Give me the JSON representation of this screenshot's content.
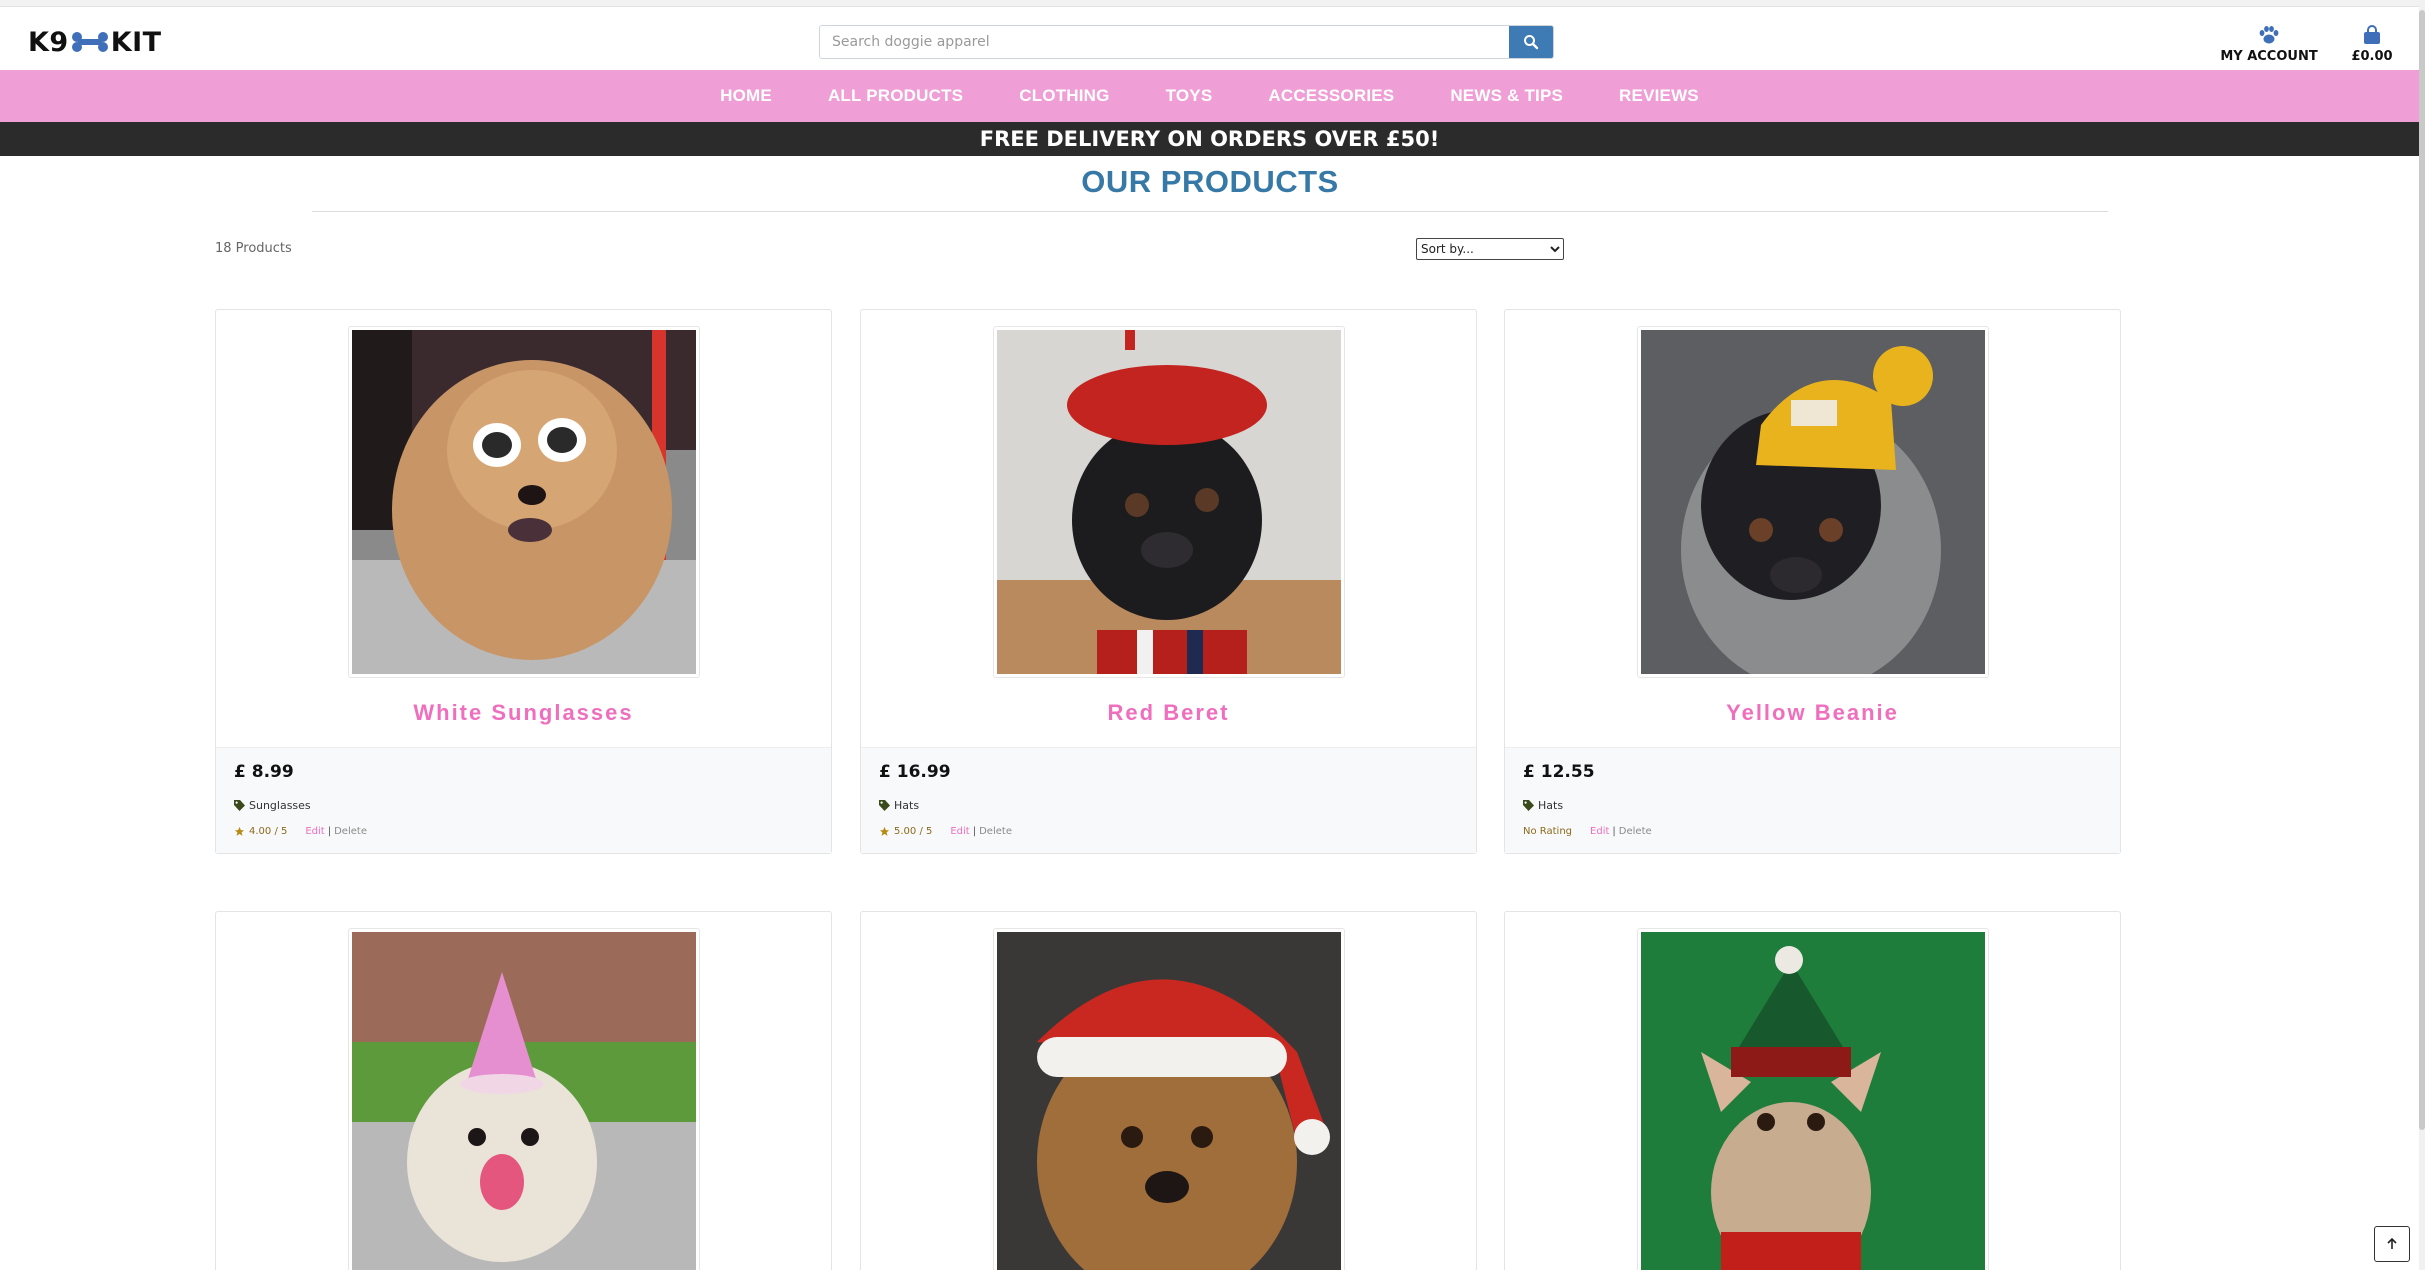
{
  "header": {
    "logo_left": "K9",
    "logo_right": "KIT",
    "search_placeholder": "Search doggie apparel",
    "account_label": "MY ACCOUNT",
    "cart_total": "£0.00"
  },
  "nav": {
    "items": [
      "HOME",
      "ALL PRODUCTS",
      "CLOTHING",
      "TOYS",
      "ACCESSORIES",
      "NEWS & TIPS",
      "REVIEWS"
    ]
  },
  "banner": {
    "text": "FREE DELIVERY ON ORDERS OVER £50!"
  },
  "main": {
    "title": "OUR PRODUCTS",
    "product_count": "18 Products",
    "sort_selected": "Sort by...",
    "products": [
      {
        "name": "White Sunglasses",
        "price": "£ 8.99",
        "category": "Sunglasses",
        "rating": "4.00 / 5",
        "edit": "Edit",
        "delete": "Delete"
      },
      {
        "name": "Red Beret",
        "price": "£ 16.99",
        "category": "Hats",
        "rating": "5.00 / 5",
        "edit": "Edit",
        "delete": "Delete"
      },
      {
        "name": "Yellow Beanie",
        "price": "£ 12.55",
        "category": "Hats",
        "rating": "No Rating",
        "edit": "Edit",
        "delete": "Delete"
      }
    ]
  },
  "colors": {
    "nav_pink": "#ef9fd5",
    "product_pink": "#ef6fbe",
    "title_blue": "#3679a7",
    "search_blue": "#3e7bb5",
    "banner_dark": "#2b2b2b"
  },
  "icons": [
    "bone-icon",
    "search-icon",
    "paw-icon",
    "shopping-bag-icon",
    "tag-icon",
    "star-icon",
    "arrow-up-icon"
  ]
}
